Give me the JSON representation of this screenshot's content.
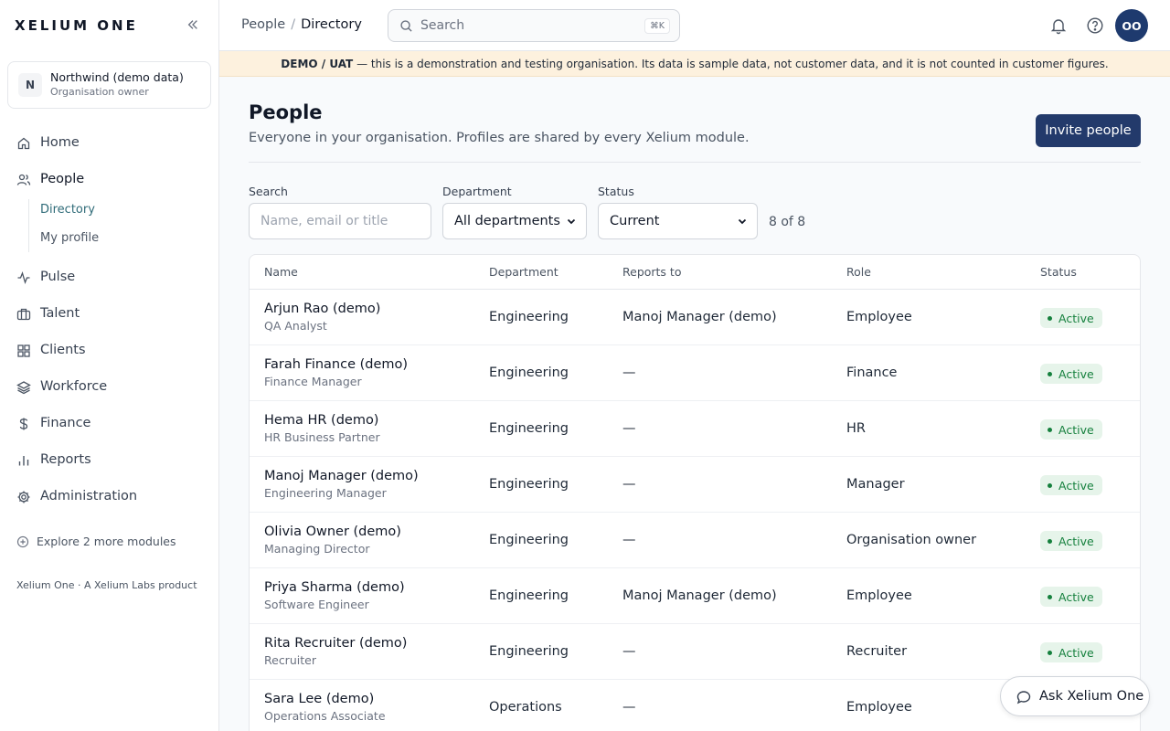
{
  "brand": "XELIUM ONE",
  "org": {
    "initial": "N",
    "name": "Northwind (demo data)",
    "role": "Organisation owner"
  },
  "nav": {
    "home": "Home",
    "people": "People",
    "people_sub": [
      "Directory",
      "My profile"
    ],
    "pulse": "Pulse",
    "talent": "Talent",
    "clients": "Clients",
    "workforce": "Workforce",
    "finance": "Finance",
    "reports": "Reports",
    "administration": "Administration",
    "explore": "Explore 2 more modules",
    "footer": "Xelium One · A Xelium Labs product"
  },
  "topbar": {
    "breadcrumb": [
      "People",
      "Directory"
    ],
    "search_placeholder": "Search",
    "search_shortcut": "⌘K",
    "avatar_initials": "OO"
  },
  "banner": {
    "tag": "DEMO / UAT",
    "text": " — this is a demonstration and testing organisation. Its data is sample data, not customer data, and it is not counted in customer figures."
  },
  "page": {
    "title": "People",
    "subtitle": "Everyone in your organisation. Profiles are shared by every Xelium module.",
    "invite_label": "Invite people"
  },
  "filters": {
    "search_label": "Search",
    "search_placeholder": "Name, email or title",
    "department_label": "Department",
    "department_value": "All departments",
    "status_label": "Status",
    "status_value": "Current",
    "count": "8 of 8"
  },
  "table": {
    "columns": [
      "Name",
      "Department",
      "Reports to",
      "Role",
      "Status"
    ],
    "rows": [
      {
        "name": "Arjun Rao (demo)",
        "title": "QA Analyst",
        "department": "Engineering",
        "reports_to": "Manoj Manager (demo)",
        "role": "Employee",
        "status": "Active"
      },
      {
        "name": "Farah Finance (demo)",
        "title": "Finance Manager",
        "department": "Engineering",
        "reports_to": "—",
        "role": "Finance",
        "status": "Active"
      },
      {
        "name": "Hema HR (demo)",
        "title": "HR Business Partner",
        "department": "Engineering",
        "reports_to": "—",
        "role": "HR",
        "status": "Active"
      },
      {
        "name": "Manoj Manager (demo)",
        "title": "Engineering Manager",
        "department": "Engineering",
        "reports_to": "—",
        "role": "Manager",
        "status": "Active"
      },
      {
        "name": "Olivia Owner (demo)",
        "title": "Managing Director",
        "department": "Engineering",
        "reports_to": "—",
        "role": "Organisation owner",
        "status": "Active"
      },
      {
        "name": "Priya Sharma (demo)",
        "title": "Software Engineer",
        "department": "Engineering",
        "reports_to": "Manoj Manager (demo)",
        "role": "Employee",
        "status": "Active"
      },
      {
        "name": "Rita Recruiter (demo)",
        "title": "Recruiter",
        "department": "Engineering",
        "reports_to": "—",
        "role": "Recruiter",
        "status": "Active"
      },
      {
        "name": "Sara Lee (demo)",
        "title": "Operations Associate",
        "department": "Operations",
        "reports_to": "—",
        "role": "Employee",
        "status": ""
      }
    ]
  },
  "ask": {
    "label": "Ask Xelium One"
  }
}
